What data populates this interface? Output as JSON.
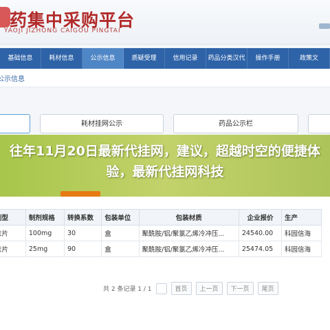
{
  "header": {
    "title": "药集中采购平台",
    "subtitle": "YAOJI JIZHONG CAIGOU PINGTAI"
  },
  "nav": {
    "items": [
      {
        "label": "基础信息",
        "active": false
      },
      {
        "label": "耗材信息",
        "active": false
      },
      {
        "label": "公示信息",
        "active": true
      },
      {
        "label": "质疑受理",
        "active": false
      },
      {
        "label": "信用记录",
        "active": false
      },
      {
        "label": "药品分类汉代",
        "active": false
      },
      {
        "label": "操作手册",
        "active": false
      },
      {
        "label": "政策文",
        "active": false
      }
    ]
  },
  "breadcrumb": "公示信息",
  "filters": [
    {
      "label": ""
    },
    {
      "label": "耗材挂网公示"
    },
    {
      "label": "药品公示栏"
    },
    {
      "label": ""
    }
  ],
  "banner": {
    "headline": "往年11月20日最新代挂网，建议，超越时空的便捷体验，最新代挂网科技"
  },
  "table": {
    "headers": [
      "剂型",
      "制剂规格",
      "转换系数",
      "包装单位",
      "包装材质",
      "企业报价",
      "生产"
    ],
    "rows": [
      [
        "衣片",
        "100mg",
        "30",
        "盒",
        "聚酰胺/铝/聚氯乙烯冷冲压...",
        "24540.00",
        "科园信海"
      ],
      [
        "衣片",
        "25mg",
        "90",
        "盒",
        "聚酰胺/铝/聚氯乙烯冷冲压...",
        "25474.05",
        "科园信海"
      ]
    ]
  },
  "pager": {
    "summary": "共 2 条记录 1 / 1",
    "first": "首页",
    "prev": "上一页",
    "next": "下一页",
    "last": "尾页"
  }
}
